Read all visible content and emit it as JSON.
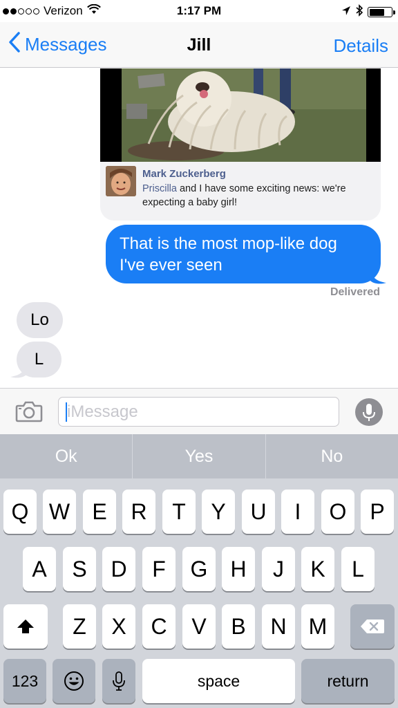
{
  "status_bar": {
    "carrier": "Verizon",
    "time": "1:17 PM",
    "signal_filled_dots": 2,
    "signal_total_dots": 5,
    "battery_level": 0.7
  },
  "nav": {
    "back_label": "Messages",
    "title": "Jill",
    "details_label": "Details"
  },
  "conversation": {
    "link_preview": {
      "author": "Mark Zuckerberg",
      "mention": "Priscilla",
      "text": " and I have some exciting news: we're expecting a baby girl!"
    },
    "outgoing_message": "That is the most mop-like dog I've ever seen",
    "delivered_label": "Delivered",
    "incoming_messages": [
      "Lo",
      "L"
    ]
  },
  "input_bar": {
    "placeholder": "iMessage",
    "value": ""
  },
  "keyboard": {
    "suggestions": [
      "Ok",
      "Yes",
      "No"
    ],
    "row1": [
      "Q",
      "W",
      "E",
      "R",
      "T",
      "Y",
      "U",
      "I",
      "O",
      "P"
    ],
    "row2": [
      "A",
      "S",
      "D",
      "F",
      "G",
      "H",
      "J",
      "K",
      "L"
    ],
    "row3": [
      "Z",
      "X",
      "C",
      "V",
      "B",
      "N",
      "M"
    ],
    "numbers_label": "123",
    "space_label": "space",
    "return_label": "return",
    "icons": {
      "shift": "shift-arrow-icon",
      "delete": "backspace-icon",
      "emoji": "emoji-icon",
      "dictation": "microphone-icon"
    }
  },
  "colors": {
    "ios_blue": "#1a7ef5",
    "incoming_bubble": "#e5e5ea",
    "keyboard_bg": "#d2d5db"
  }
}
